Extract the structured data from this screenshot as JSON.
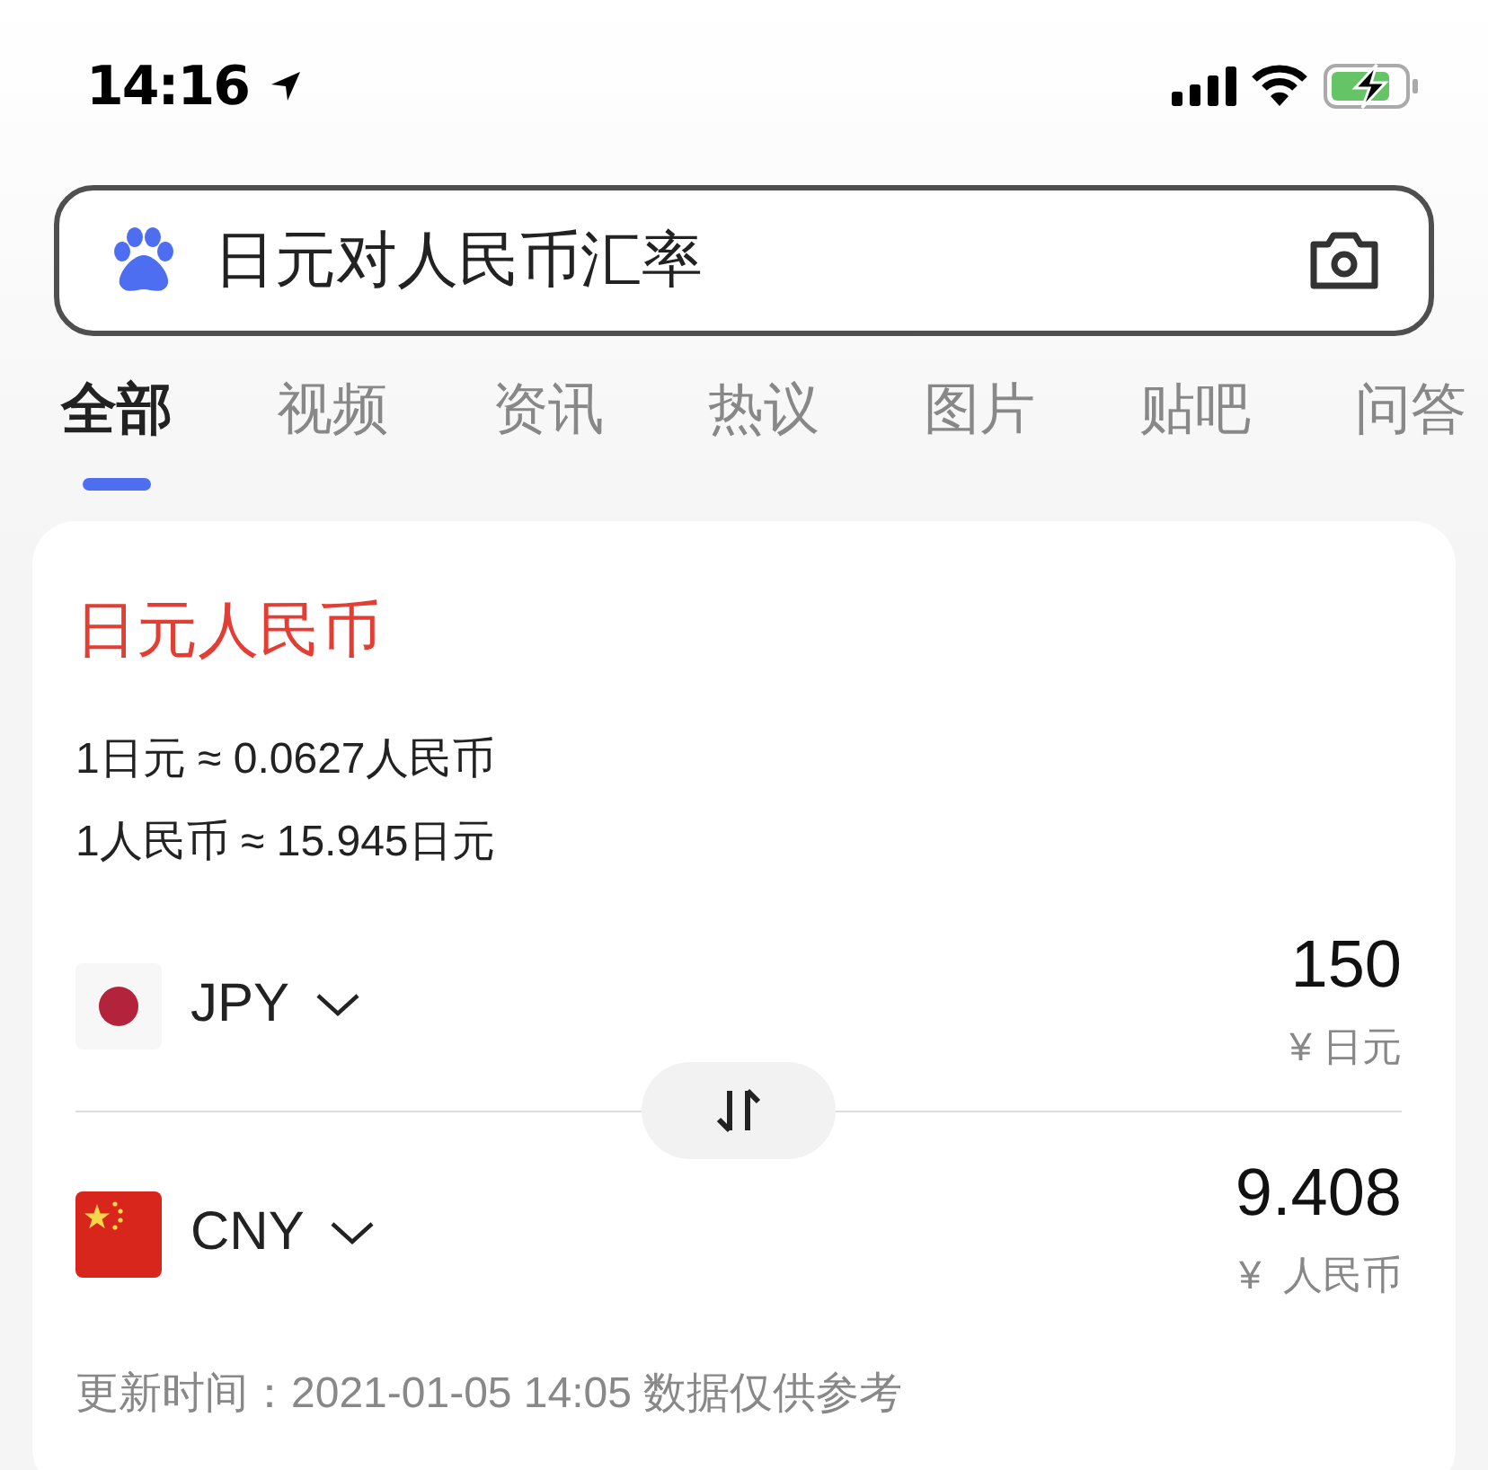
{
  "status_bar": {
    "time": "14:16"
  },
  "search": {
    "value": "日元对人民币汇率"
  },
  "tabs": [
    {
      "label": "全部",
      "selected": true
    },
    {
      "label": "视频",
      "selected": false
    },
    {
      "label": "资讯",
      "selected": false
    },
    {
      "label": "热议",
      "selected": false
    },
    {
      "label": "图片",
      "selected": false
    },
    {
      "label": "贴吧",
      "selected": false
    },
    {
      "label": "问答",
      "selected": false
    }
  ],
  "card": {
    "title": "日元人民币",
    "rates": [
      "1日元 ≈ 0.0627人民币",
      "1人民币 ≈ 15.945日元"
    ],
    "currencies": [
      {
        "kind": "jp",
        "code": "JPY",
        "amount": "150",
        "unit": "¥ 日元"
      },
      {
        "kind": "cn",
        "code": "CNY",
        "amount": "9.408",
        "unit": "¥  人民币"
      }
    ],
    "footer": "更新时间：2021-01-05 14:05 数据仅供参考"
  }
}
